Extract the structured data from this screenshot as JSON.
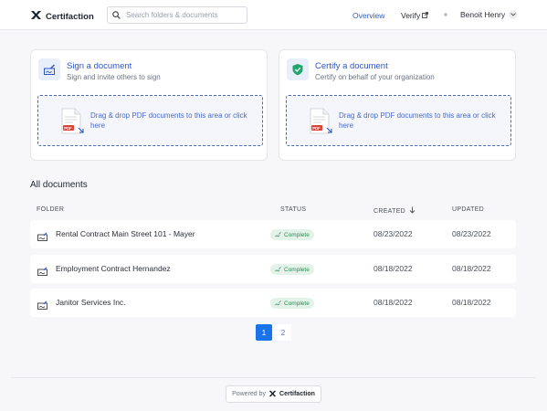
{
  "header": {
    "app_name": "Certifaction",
    "search_placeholder": "Search folders & documents",
    "nav": {
      "overview": "Overview",
      "verify": "Verify"
    },
    "user": "Benoit Henry"
  },
  "cards": {
    "sign": {
      "title": "Sign a document",
      "subtitle": "Sign and invite others to sign",
      "drop_text": "Drag & drop PDF documents to this area or click here"
    },
    "certify": {
      "title": "Certify a document",
      "subtitle": "Certify on behalf of your organization",
      "drop_text": "Drag & drop PDF documents to this area or click here"
    }
  },
  "documents": {
    "title": "All documents",
    "columns": {
      "folder": "FOLDER",
      "status": "STATUS",
      "created": "CREATED",
      "updated": "UPDATED"
    },
    "rows": [
      {
        "name": "Rental Contract Main Street 101 - Mayer",
        "status": "Complete",
        "created": "08/23/2022",
        "updated": "08/23/2022"
      },
      {
        "name": "Employment Contract Hernandez",
        "status": "Complete",
        "created": "08/18/2022",
        "updated": "08/18/2022"
      },
      {
        "name": "Janitor Services Inc.",
        "status": "Complete",
        "created": "08/18/2022",
        "updated": "08/18/2022"
      }
    ]
  },
  "pagination": {
    "pages": [
      "1",
      "2"
    ],
    "current": "1"
  },
  "footer": {
    "powered_by": "Powered by",
    "brand": "Certifaction"
  },
  "colors": {
    "accent": "#2f56c2",
    "primary_button": "#1a73e8",
    "status_complete": "#2f8a55",
    "certify_check": "#1fa66a"
  },
  "icons": {
    "logo": "certifaction-logo-icon",
    "search": "search-icon",
    "external": "external-link-icon",
    "user_menu": "chevron-down-icon",
    "sign": "sign-document-icon",
    "certify": "shield-check-icon",
    "pdf": "pdf-file-icon",
    "sort": "arrow-down-icon",
    "status": "signature-icon"
  }
}
